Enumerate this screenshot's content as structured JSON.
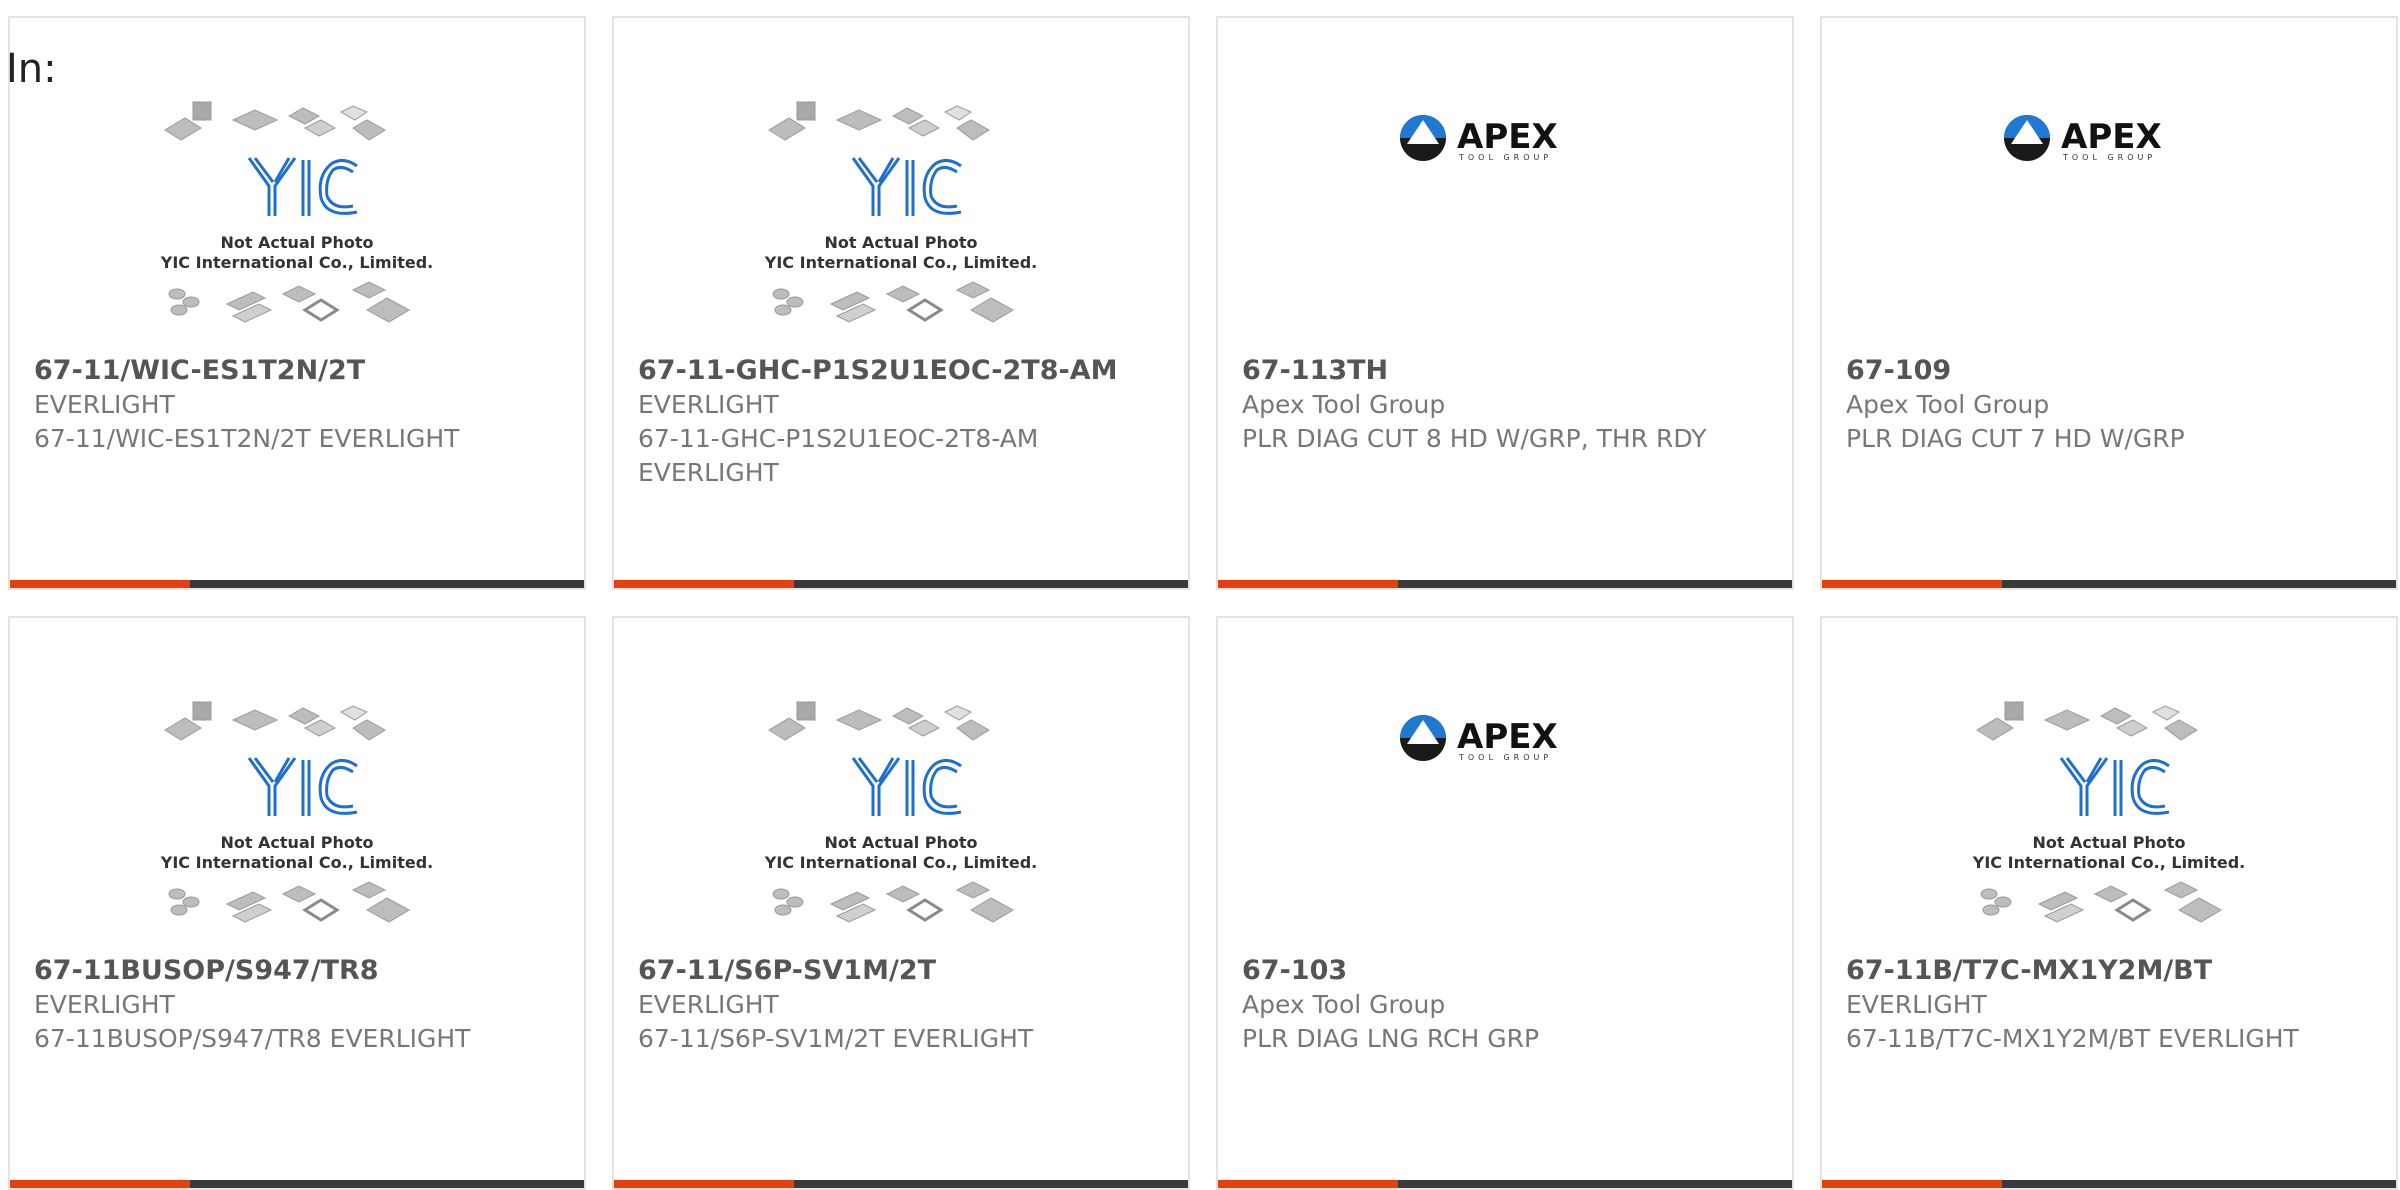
{
  "label": "In:",
  "colors": {
    "accent": "#e8400c",
    "bar": "#3a3a3a",
    "yic_blue": "#1f6fd0"
  },
  "yic_logo": {
    "caption_line1": "Not Actual Photo",
    "caption_line2": "YIC International Co., Limited."
  },
  "apex_logo": {
    "word": "APEX",
    "tagline": "TOOL GROUP"
  },
  "products": [
    {
      "part": "67-11/WIC-ES1T2N/2T",
      "brand": "EVERLIGHT",
      "desc": "67-11/WIC-ES1T2N/2T EVERLIGHT",
      "image": "yic-placeholder"
    },
    {
      "part": "67-11-GHC-P1S2U1EOC-2T8-AM",
      "brand": "EVERLIGHT",
      "desc": "67-11-GHC-P1S2U1EOC-2T8-AM EVERLIGHT",
      "image": "yic-placeholder"
    },
    {
      "part": "67-113TH",
      "brand": "Apex Tool Group",
      "desc": "PLR DIAG CUT 8 HD W/GRP, THR RDY",
      "image": "apex-logo"
    },
    {
      "part": "67-109",
      "brand": "Apex Tool Group",
      "desc": "PLR DIAG CUT 7 HD W/GRP",
      "image": "apex-logo"
    },
    {
      "part": "67-11BUSOP/S947/TR8",
      "brand": "EVERLIGHT",
      "desc": "67-11BUSOP/S947/TR8 EVERLIGHT",
      "image": "yic-placeholder"
    },
    {
      "part": "67-11/S6P-SV1M/2T",
      "brand": "EVERLIGHT",
      "desc": "67-11/S6P-SV1M/2T EVERLIGHT",
      "image": "yic-placeholder"
    },
    {
      "part": "67-103",
      "brand": "Apex Tool Group",
      "desc": "PLR DIAG LNG RCH GRP",
      "image": "apex-logo"
    },
    {
      "part": "67-11B/T7C-MX1Y2M/BT",
      "brand": "EVERLIGHT",
      "desc": "67-11B/T7C-MX1Y2M/BT EVERLIGHT",
      "image": "yic-placeholder"
    }
  ]
}
